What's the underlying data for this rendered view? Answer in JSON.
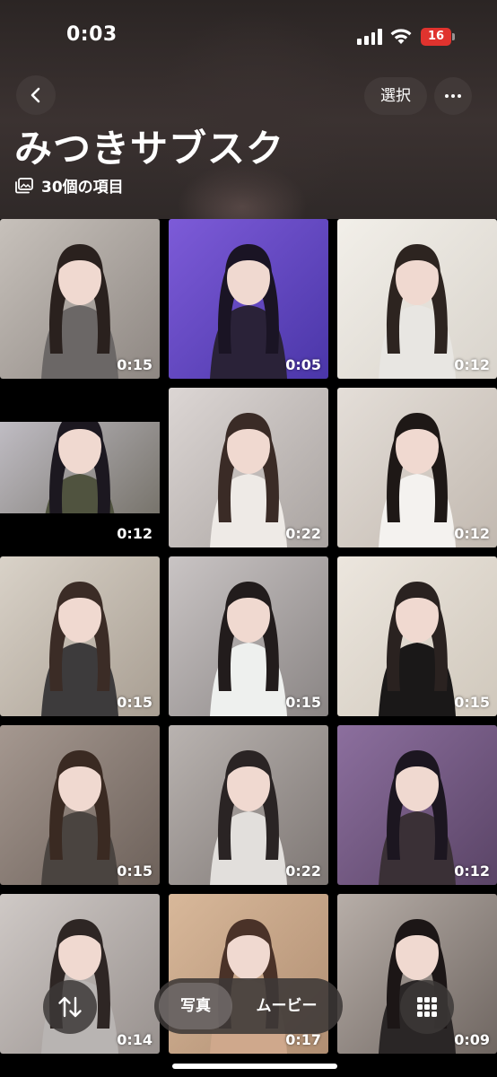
{
  "status_bar": {
    "time": "0:03",
    "battery_level": "16",
    "battery_color": "#e0332e"
  },
  "nav": {
    "select_label": "選択",
    "back_icon": "chevron-left-icon",
    "more_icon": "ellipsis-icon"
  },
  "album": {
    "title": "みつきサブスク",
    "count_label": "30個の項目",
    "count_icon": "photo-stack-icon"
  },
  "grid": {
    "items": [
      {
        "duration": "0:15",
        "bg": "#c7c1bb",
        "bg2": "#8e8782",
        "hair": "#2a211e",
        "shirt": "#6b6766"
      },
      {
        "duration": "0:05",
        "bg": "#7d5bd8",
        "bg2": "#4a36a8",
        "hair": "#1a1424",
        "shirt": "#2a2238"
      },
      {
        "duration": "0:12",
        "bg": "#f2efe9",
        "bg2": "#d9d4cc",
        "hair": "#2d2420",
        "shirt": "#e8e6e2"
      },
      {
        "duration": "0:12",
        "bg": "#c9c6cf",
        "bg2": "#6e6a60",
        "hair": "#1c1820",
        "shirt": "#50533f",
        "letterbox": true
      },
      {
        "duration": "0:22",
        "bg": "#dcd6d4",
        "bg2": "#a9a3a0",
        "hair": "#3a2b26",
        "shirt": "#eeeae6"
      },
      {
        "duration": "0:12",
        "bg": "#e4ded8",
        "bg2": "#c2b9b0",
        "hair": "#1e1816",
        "shirt": "#f4f2ef"
      },
      {
        "duration": "0:15",
        "bg": "#d9d2c8",
        "bg2": "#a89e92",
        "hair": "#3b2c26",
        "shirt": "#3d3b3c"
      },
      {
        "duration": "0:15",
        "bg": "#c9c4c4",
        "bg2": "#8a8584",
        "hair": "#221c1c",
        "shirt": "#eef0ee"
      },
      {
        "duration": "0:15",
        "bg": "#ece6de",
        "bg2": "#d0c8bc",
        "hair": "#2a2220",
        "shirt": "#1a1818"
      },
      {
        "duration": "0:15",
        "bg": "#a59890",
        "bg2": "#6d615a",
        "hair": "#3a2a22",
        "shirt": "#4a4440"
      },
      {
        "duration": "0:22",
        "bg": "#b9b3b0",
        "bg2": "#7e7774",
        "hair": "#2a2424",
        "shirt": "#e2dfdc"
      },
      {
        "duration": "0:12",
        "bg": "#8c6f9e",
        "bg2": "#5a4466",
        "hair": "#1c1620",
        "shirt": "#3a3036"
      },
      {
        "duration": "0:14",
        "bg": "#cfc9c6",
        "bg2": "#98918e",
        "hair": "#2e2624",
        "shirt": "#b8b4b2"
      },
      {
        "duration": "0:17",
        "bg": "#d8b89a",
        "bg2": "#b08e72",
        "hair": "#4a3228",
        "shirt": "#cfa88c"
      },
      {
        "duration": "0:09",
        "bg": "#b7aea8",
        "bg2": "#6f6661",
        "hair": "#1c1616",
        "shirt": "#2a2626"
      }
    ]
  },
  "bottom_bar": {
    "sort_icon": "sort-arrows-icon",
    "segment_photos": "写真",
    "segment_movies": "ムービー",
    "grid_icon": "grid-icon"
  }
}
